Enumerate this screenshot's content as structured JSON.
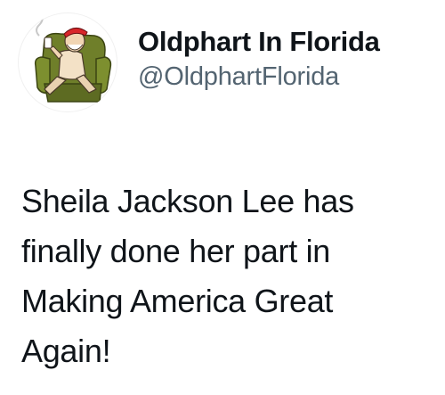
{
  "tweet": {
    "author": {
      "display_name": "Oldphart In Florida",
      "handle": "@OldphartFlorida",
      "avatar_icon": "cartoon-old-man-in-armchair-icon"
    },
    "text_lines": [
      "Sheila Jackson Lee has",
      "finally done her part in",
      "Making America Great",
      "Again!"
    ]
  },
  "colors": {
    "text_primary": "#0f1419",
    "text_secondary": "#536471",
    "avatar_chair": "#6f7f2a",
    "avatar_hat": "#d8262a",
    "background": "#ffffff"
  }
}
